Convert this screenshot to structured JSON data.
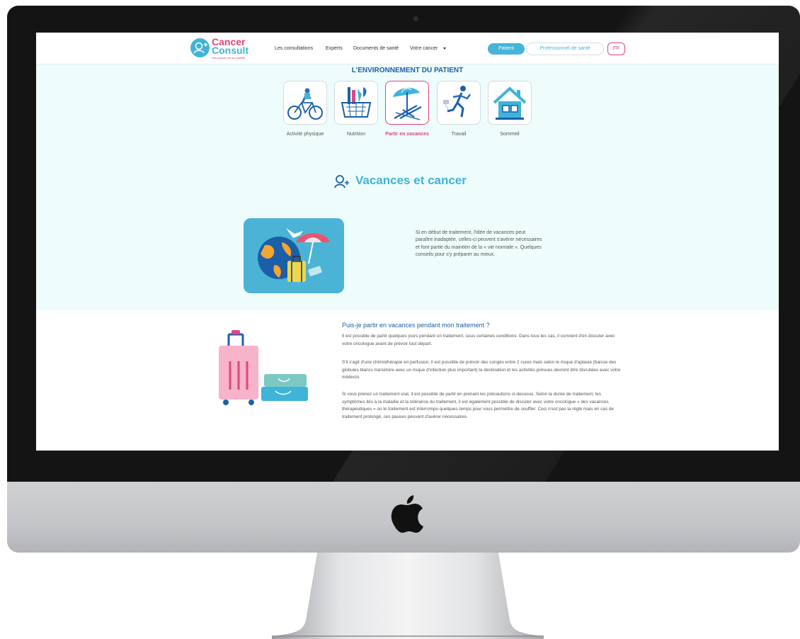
{
  "nav": {
    "logo_line1": "Cancer",
    "logo_line2": "Consult",
    "logo_tagline": "Des acteurs de sa maladie",
    "links": [
      "Les consultations",
      "Experts",
      "Documents de santé",
      "Votre cancer"
    ],
    "patient_button": "Patient",
    "pro_button": "Professionnel de santé",
    "lang_button": "FR"
  },
  "environment": {
    "title": "L'ENVIRONNEMENT DU PATIENT",
    "categories": [
      {
        "label": "Activité physique",
        "icon": "bicycle-icon"
      },
      {
        "label": "Nutrition",
        "icon": "grocery-basket-icon"
      },
      {
        "label": "Partir en vacances",
        "icon": "beach-umbrella-icon",
        "active": true
      },
      {
        "label": "Travail",
        "icon": "runner-icon"
      },
      {
        "label": "Sommeil",
        "icon": "house-icon"
      }
    ]
  },
  "section": {
    "title": "Vacances et cancer",
    "intro": "Si en début de traitement, l'idée de vacances peut paraître inadaptée, celles-ci peuvent s'avérer nécessaires et font partie du maintien de la « vie normale ». Quelques conseils pour s'y préparer au mieux."
  },
  "faq": {
    "question": "Puis-je partir en vacances pendant mon traitement ?",
    "paragraphs": [
      "Il est possible de partir quelques jours pendant un traitement, sous certaines conditions. Dans tous les cas, il convient d'en discuter avec votre oncologue avant de prévoir tout départ.",
      "S'il s'agit d'une chimiothérapie en perfusion, il est possible de prévoir des congés entre 2 cures mais selon le risque d'aplasie (baisse des globules blancs transitoire avec un risque d'infection plus important) la destination et les activités prévues devront être discutées avec votre médecin.",
      "Si vous prenez un traitement oral, il est possible de partir en prenant les précautions ci-dessous. Selon la durée de traitement, les symptômes liés à la maladie et la tolérance du traitement, il est également possible de discuter avec votre oncologue « des vacances thérapeutiques » où le traitement est interrompu quelques temps pour vous permettre de souffler. Ceci n'est pas la règle mais en cas de traitement prolongé, ces pauses peuvent d'avérer nécessaires."
    ]
  },
  "colors": {
    "brand_pink": "#e0467c",
    "brand_blue": "#3fb4d8",
    "title_blue": "#1b5fa8",
    "background": "#eefcfb"
  }
}
